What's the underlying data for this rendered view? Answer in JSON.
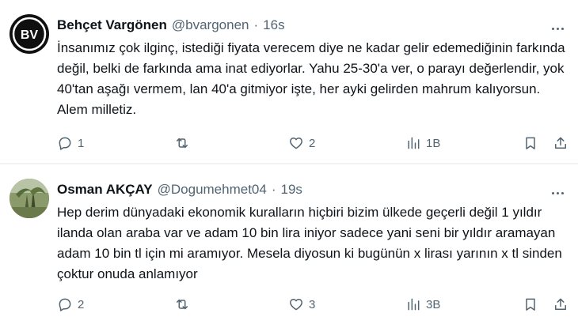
{
  "tweets": [
    {
      "display_name": "Behçet Vargönen",
      "handle": "@bvargonen",
      "separator": "·",
      "time": "16s",
      "avatar_monogram": "BV",
      "text": "İnsanımız çok ilginç, istediği fiyata verecem diye ne kadar gelir edemediğinin farkında değil, belki de farkında ama inat ediyorlar. Yahu 25-30'a ver, o parayı değerlendir, yok 40'tan aşağı vermem, lan 40'a gitmiyor işte, her ayki gelirden mahrum kalıyorsun. Alem milletiz.",
      "replies": "1",
      "retweets": "",
      "likes": "2",
      "views": "1B"
    },
    {
      "display_name": "Osman AKÇAY",
      "handle": "@Dogumehmet04",
      "separator": "·",
      "time": "19s",
      "avatar_monogram": "",
      "text": "Hep derim dünyadaki ekonomik kuralların hiçbiri bizim ülkede geçerli değil 1 yıldır ilanda olan araba var ve adam 10 bin lira iniyor sadece yani seni bir yıldır aramayan adam 10 bin tl için mi aramıyor. Mesela diyosun ki bugünün x lirası yarının x tl sinden çoktur onuda anlamıyor",
      "replies": "2",
      "retweets": "",
      "likes": "3",
      "views": "3B"
    }
  ],
  "icons": {
    "reply": "reply-icon",
    "retweet": "retweet-icon",
    "like": "heart-icon",
    "views": "views-chart-icon",
    "bookmark": "bookmark-icon",
    "share": "share-icon",
    "more": "more-dots-icon"
  },
  "colors": {
    "text": "#0f1419",
    "secondary": "#536471",
    "divider": "#eff3f4"
  }
}
